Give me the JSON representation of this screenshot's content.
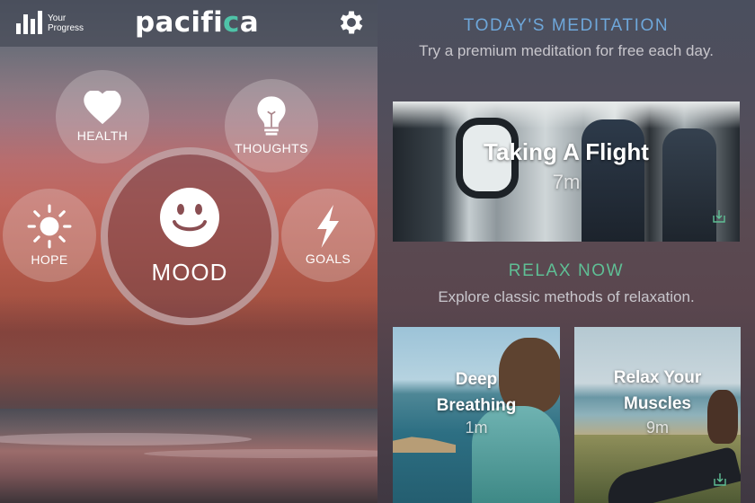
{
  "left_screen": {
    "header": {
      "progress_label_line1": "Your",
      "progress_label_line2": "Progress",
      "logo_text_a": "pacifi",
      "logo_text_c": "c",
      "logo_text_b": "a",
      "settings_icon": "gear-icon"
    },
    "circles": {
      "health": {
        "label": "HEALTH",
        "icon": "heart-icon"
      },
      "thoughts": {
        "label": "THOUGHTS",
        "icon": "lightbulb-icon"
      },
      "hope": {
        "label": "HOPE",
        "icon": "sun-icon"
      },
      "goals": {
        "label": "GOALS",
        "icon": "lightning-icon"
      },
      "mood": {
        "label": "MOOD",
        "icon": "smiley-icon"
      }
    }
  },
  "right_screen": {
    "todays_meditation": {
      "title": "TODAY'S MEDITATION",
      "subtitle": "Try a premium meditation for free each day.",
      "card": {
        "name": "Taking A Flight",
        "duration": "7m",
        "icon": "download-icon"
      }
    },
    "relax_now": {
      "title": "RELAX NOW",
      "subtitle": "Explore classic methods of relaxation.",
      "cards": [
        {
          "name_line1": "Deep",
          "name_line2": "Breathing",
          "duration": "1m"
        },
        {
          "name_line1": "Relax Your",
          "name_line2": "Muscles",
          "duration": "9m",
          "icon": "download-icon"
        }
      ]
    }
  },
  "colors": {
    "accent_blue": "#6ea7da",
    "accent_green": "#5fbf95",
    "logo_accent": "#4fc3a8"
  }
}
